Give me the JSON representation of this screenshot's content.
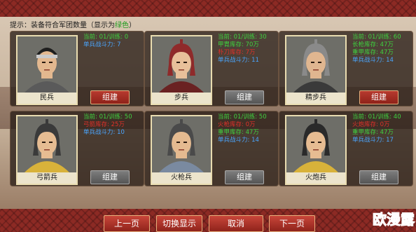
{
  "hint": {
    "prefix": "提示：装备符合军团数量（显示为",
    "green_word": "绿色",
    "suffix": "）"
  },
  "units": [
    {
      "name": "民兵",
      "lines": [
        {
          "text": "当前: 01/训练: 0",
          "color": "green"
        },
        {
          "text": "单兵战斗力: 7",
          "color": "blue"
        }
      ],
      "button": "组建",
      "button_state": "red",
      "portrait_style": "headband",
      "palette": {
        "helmet": "#c9c9c9",
        "armor": "#5a5a5a",
        "face": "#e3b88f"
      }
    },
    {
      "name": "步兵",
      "lines": [
        {
          "text": "当前: 01/训练: 30",
          "color": "green"
        },
        {
          "text": "甲胄库存: 70万",
          "color": "green"
        },
        {
          "text": "朴刀库存: 7万",
          "color": "red"
        },
        {
          "text": "单兵战斗力: 11",
          "color": "blue"
        }
      ],
      "button": "组建",
      "button_state": "grey",
      "portrait_style": "helmet",
      "palette": {
        "helmet": "#8f2a2a",
        "armor": "#6a2222",
        "face": "#e8c09a"
      }
    },
    {
      "name": "精步兵",
      "lines": [
        {
          "text": "当前: 01/训练: 60",
          "color": "green"
        },
        {
          "text": "长枪库存: 47万",
          "color": "green"
        },
        {
          "text": "重甲库存: 47万",
          "color": "green"
        },
        {
          "text": "单兵战斗力: 14",
          "color": "blue"
        }
      ],
      "button": "组建",
      "button_state": "red",
      "portrait_style": "helmet",
      "palette": {
        "helmet": "#8a8a8a",
        "armor": "#3a3a3a",
        "face": "#e0b690"
      }
    },
    {
      "name": "弓箭兵",
      "lines": [
        {
          "text": "当前: 01/训练: 50",
          "color": "green"
        },
        {
          "text": "弓箭库存: 25万",
          "color": "red"
        },
        {
          "text": "单兵战斗力: 10",
          "color": "blue"
        }
      ],
      "button": "组建",
      "button_state": "grey",
      "portrait_style": "helmet",
      "palette": {
        "helmet": "#3a3a3a",
        "armor": "#d8b23a",
        "face": "#e6bc92"
      }
    },
    {
      "name": "火枪兵",
      "lines": [
        {
          "text": "当前: 01/训练: 50",
          "color": "green"
        },
        {
          "text": "火枪库存: 0万",
          "color": "red"
        },
        {
          "text": "重甲库存: 47万",
          "color": "green"
        },
        {
          "text": "单兵战斗力: 14",
          "color": "blue"
        }
      ],
      "button": "组建",
      "button_state": "grey",
      "portrait_style": "helmet",
      "palette": {
        "helmet": "#4a4a4a",
        "armor": "#7a8aa0",
        "face": "#e4ba90"
      }
    },
    {
      "name": "火炮兵",
      "lines": [
        {
          "text": "当前: 01/训练: 40",
          "color": "green"
        },
        {
          "text": "火炮库存: 0万",
          "color": "red"
        },
        {
          "text": "重甲库存: 47万",
          "color": "green"
        },
        {
          "text": "单兵战斗力: 17",
          "color": "blue"
        }
      ],
      "button": "组建",
      "button_state": "grey",
      "portrait_style": "helmet",
      "palette": {
        "helmet": "#2a2a2a",
        "armor": "#d8b23a",
        "face": "#e6bc92"
      }
    }
  ],
  "footer": {
    "prev": "上一页",
    "toggle": "切换显示",
    "cancel": "取消",
    "next": "下一页"
  },
  "watermark": "欧漫露",
  "colors": {
    "accent_red": "#b73a2f",
    "stat_green": "#3fd23f",
    "stat_blue": "#4aa6ff",
    "stat_red": "#e0302a",
    "hint_green": "#1c9a1c"
  }
}
